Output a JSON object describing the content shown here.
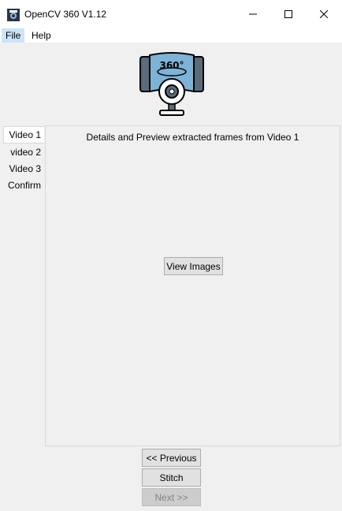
{
  "window": {
    "title": "OpenCV 360 V1.12",
    "controls": [
      "minimize-icon",
      "maximize-icon",
      "close-icon"
    ]
  },
  "menu": {
    "items": [
      {
        "label": "File"
      },
      {
        "label": "Help"
      }
    ]
  },
  "logo": {
    "text": "360°",
    "icon": "360-camera-icon"
  },
  "tabs": [
    {
      "label": "Video 1",
      "active": true
    },
    {
      "label": "video 2",
      "active": false
    },
    {
      "label": "Video 3",
      "active": false
    },
    {
      "label": "Confirm",
      "active": false
    }
  ],
  "panel": {
    "title": "Details and Preview extracted frames from Video 1",
    "view_images_label": "View Images"
  },
  "navigation": {
    "previous_label": "<< Previous",
    "stitch_label": "Stitch",
    "next_label": "Next >>",
    "next_enabled": false
  },
  "colors": {
    "menu_highlight": "#cce4f7",
    "logo_blue": "#7eb3d8",
    "logo_gray": "#5a6b7a"
  }
}
